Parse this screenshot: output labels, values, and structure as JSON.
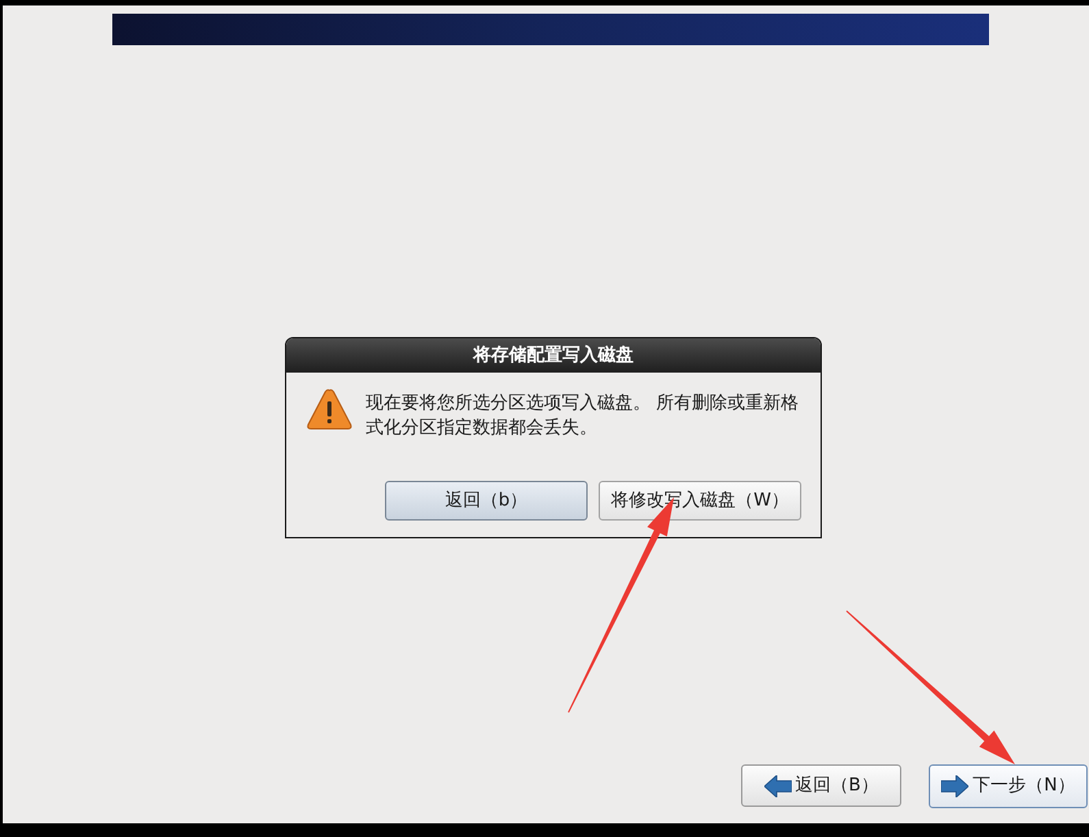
{
  "dialog": {
    "title": "将存储配置写入磁盘",
    "message": "现在要将您所选分区选项写入磁盘。 所有删除或重新格式化分区指定数据都会丢失。",
    "buttons": [
      {
        "label": "返回（b）",
        "focused": true
      },
      {
        "label": "将修改写入磁盘（W）",
        "focused": false
      }
    ]
  },
  "navigation": {
    "buttons": [
      {
        "label": "返回（B）",
        "kind": "back",
        "focused": false
      },
      {
        "label": "下一步（N）",
        "kind": "next",
        "focused": true
      }
    ]
  }
}
